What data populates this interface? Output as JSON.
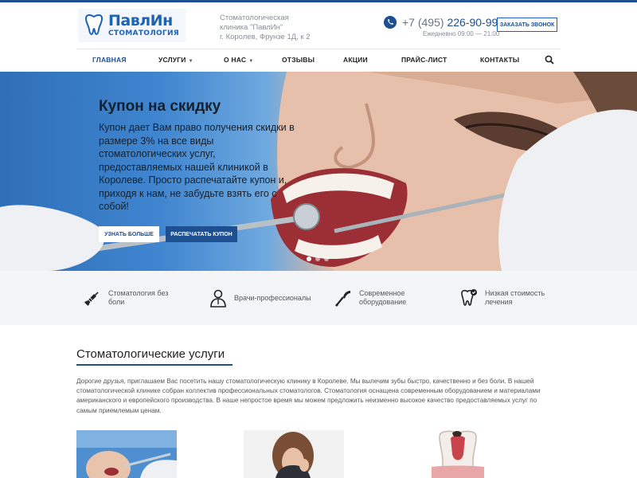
{
  "header": {
    "logo_name": "ПавлИн",
    "logo_sub": "СТОМАТОЛОГИЯ",
    "address_line1": "Стоматологическая",
    "address_line2": "клиника \"ПавлИн\"",
    "address_line3": "г. Королев, Фрунзе 1Д, к 2",
    "phone_prefix": "+7 (495)",
    "phone_number": "226-90-99",
    "hours": "Ежедневно 09:00 — 21:00",
    "callback_label": "ЗАКАЗАТЬ ЗВОНОК"
  },
  "nav": {
    "items": [
      {
        "label": "ГЛАВНАЯ"
      },
      {
        "label": "УСЛУГИ"
      },
      {
        "label": "О НАС"
      },
      {
        "label": "ОТЗЫВЫ"
      },
      {
        "label": "АКЦИИ"
      },
      {
        "label": "ПРАЙС-ЛИСТ"
      },
      {
        "label": "КОНТАКТЫ"
      }
    ]
  },
  "hero": {
    "title": "Купон на скидку",
    "text": "Купон дает Вам право получения скидки в размере 3% на все виды стоматологических услуг, предоставляемых нашей клиникой в Королеве. Просто распечатайте купон и, приходя к нам, не забудьте взять его с собой!",
    "more_label": "УЗНАТЬ БОЛЬШЕ",
    "print_label": "РАСПЕЧАТАТЬ КУПОН",
    "slide_count": 3,
    "active_slide": 1
  },
  "features": [
    {
      "icon": "syringe-icon",
      "line1": "Стоматология без",
      "line2": "боли"
    },
    {
      "icon": "doctor-icon",
      "line1": "Врачи-профессионалы",
      "line2": ""
    },
    {
      "icon": "dental-drill-icon",
      "line1": "Современное",
      "line2": "оборудование"
    },
    {
      "icon": "tooth-check-icon",
      "line1": "Низкая стоимость",
      "line2": "лечения"
    }
  ],
  "services": {
    "title": "Стоматологические услуги",
    "intro": "Дорогие друзья, приглашаем Вас посетить нашу стоматологическую клинику в Королеве. Мы вылечим зубы быстро, качественно и без боли. В нашей стоматологической клинике собран коллектив профессиональных стоматологов. Стоматология оснащена современным оборудованием и материалами американского и европейского производства. В наше непростое время мы можем предложить неизменно высокое качество предоставляемых услуг по самым приемлемым ценам."
  },
  "colors": {
    "brand": "#1d4f91",
    "logo": "#1d63b4",
    "feature_bg": "#f4f5f7"
  }
}
